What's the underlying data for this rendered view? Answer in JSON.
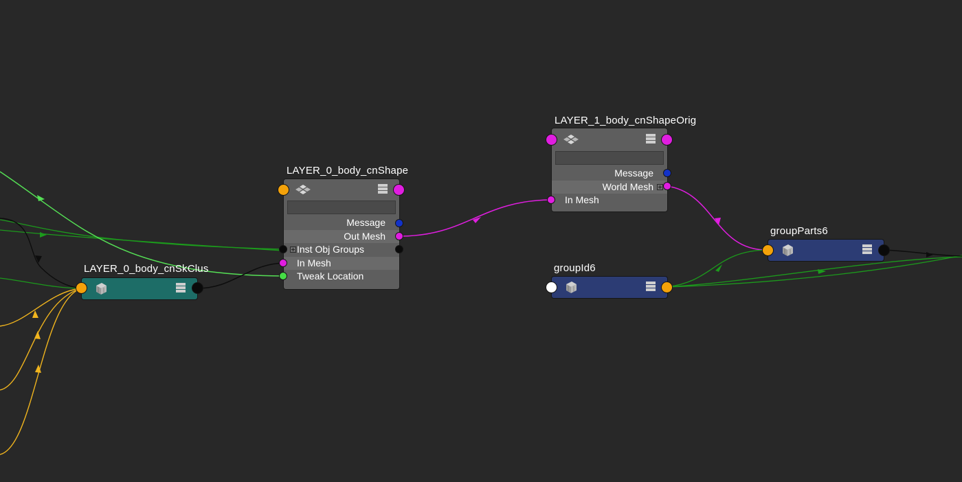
{
  "colors": {
    "background": "#282828",
    "node_body": "#5e5e5e",
    "skin_cluster": "#1d6d67",
    "group_node": "#2c3c74",
    "port_orange": "#f4a20a",
    "port_magenta": "#e01ee0",
    "port_blue": "#1232c8",
    "port_green": "#46dc46",
    "port_black": "#0a0a0a",
    "port_white": "#ffffff",
    "wire_green": "#1c9a1c",
    "wire_light_green": "#55e055",
    "wire_yellow": "#f0b41e",
    "wire_magenta": "#e01ee0",
    "wire_black": "#0d0d0d"
  },
  "nodes": {
    "skin_cluster": {
      "title": "LAYER_0_body_cnSkClus",
      "icon": "skin-cluster-icon"
    },
    "shape": {
      "title": "LAYER_0_body_cnShape",
      "icon": "mesh-shape-icon",
      "attributes": [
        {
          "label": "Message"
        },
        {
          "label": "Out Mesh"
        },
        {
          "label": "Inst Obj Groups"
        },
        {
          "label": "In Mesh"
        },
        {
          "label": "Tweak Location"
        }
      ]
    },
    "shape_orig": {
      "title": "LAYER_1_body_cnShapeOrig",
      "icon": "mesh-shape-icon",
      "attributes": [
        {
          "label": "Message"
        },
        {
          "label": "World Mesh"
        },
        {
          "label": "In Mesh"
        }
      ]
    },
    "group_id": {
      "title": "groupId6",
      "icon": "group-id-icon"
    },
    "group_parts": {
      "title": "groupParts6",
      "icon": "group-parts-icon"
    }
  }
}
